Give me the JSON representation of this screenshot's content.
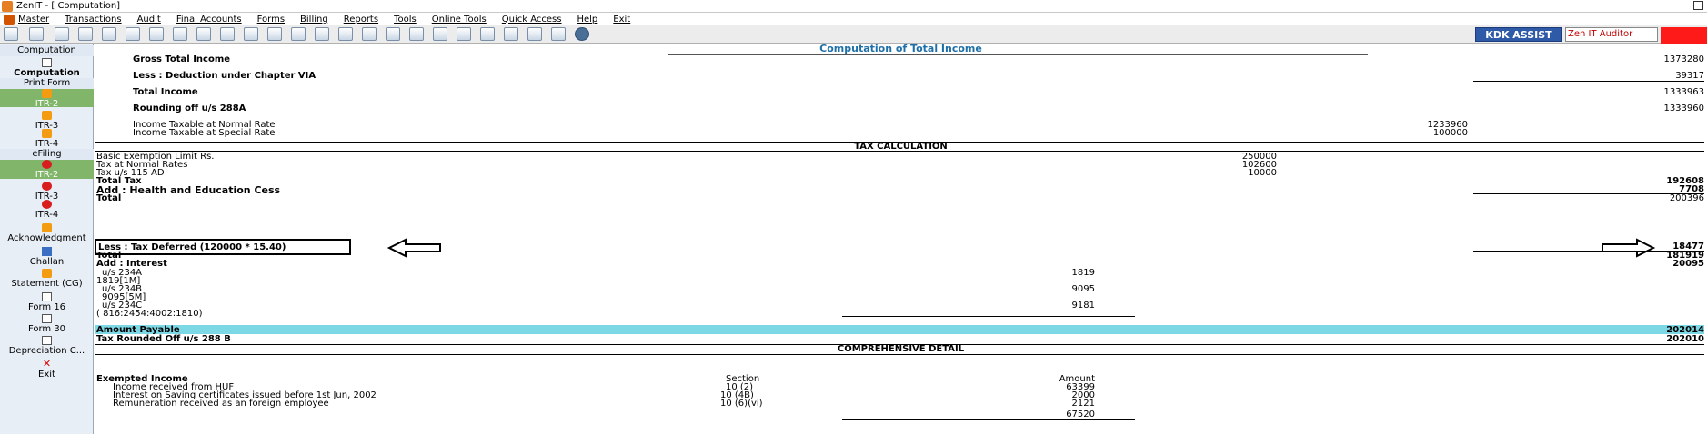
{
  "window": {
    "title": "ZenIT - [ Computation]"
  },
  "menu": [
    "Master",
    "Transactions",
    "Audit",
    "Final Accounts",
    "Forms",
    "Billing",
    "Reports",
    "Tools",
    "Online Tools",
    "Quick Access",
    "Help",
    "Exit"
  ],
  "toolbar": {
    "kdk_label": "KDK ASSIST",
    "zen_label": "Zen IT Auditor"
  },
  "sidebar": {
    "heading": "Computation",
    "computation_label": "Computation",
    "print_form_heading": "Print Form",
    "itr2_label": "ITR-2",
    "itr3_label": "ITR-3",
    "itr4_label": "ITR-4",
    "efiling_heading": "eFiling",
    "e_itr2_label": "ITR-2",
    "e_itr3_label": "ITR-3",
    "e_itr4_label": "ITR-4",
    "ack_label": "Acknowledgment",
    "challan_label": "Challan",
    "statement_label": "Statement (CG)",
    "form16_label": "Form 16",
    "form30_label": "Form 30",
    "depreciation_label": "Depreciation C...",
    "exit_label": "Exit"
  },
  "computation": {
    "title": "Computation of Total Income",
    "gross_total_label": "Gross Total Income",
    "gross_total_value": "1373280",
    "deduction_label": "Less : Deduction under Chapter VIA",
    "deduction_value": "39317",
    "total_income_label": "Total Income",
    "total_income_value": "1333963",
    "rounding_label": "Rounding off u/s 288A",
    "rounding_value": "1333960",
    "normal_rate_label": "Income Taxable at Normal Rate",
    "normal_rate_value": "1233960",
    "special_rate_label": "Income Taxable at Special Rate",
    "special_rate_value": "100000"
  },
  "tax": {
    "title": "TAX CALCULATION",
    "basic_exemption_label": "Basic Exemption Limit Rs.",
    "basic_exemption_value": "250000",
    "normal_rates_label": "Tax at Normal Rates",
    "normal_rates_value": "102600",
    "tax_115ad_label": "Tax u/s 115 AD",
    "tax_115ad_value": "10000",
    "total_tax_label": "Total Tax",
    "total_tax_value": "192608",
    "cess_label": "Add : Health and Education Cess",
    "cess_value": "7708",
    "total1_label": "Total",
    "total1_value": "200396",
    "deferred_label": "Less : Tax Deferred (120000 * 15.40)",
    "deferred_value": "18477",
    "total2_label": "Total",
    "total2_value": "181919",
    "add_interest_label": "Add : Interest",
    "add_interest_value": "20095",
    "i234a_label": "u/s 234A",
    "i234a_value": "1819",
    "i234a_detail": "1819[1M]",
    "i234b_label": "u/s 234B",
    "i234b_value": "9095",
    "i234b_detail": "9095[5M]",
    "i234c_label": "u/s 234C",
    "i234c_value": "9181",
    "i234c_detail": "( 816:2454:4002:1810)",
    "payable_label": "Amount Payable",
    "payable_value": "202014",
    "rounded_label": "Tax Rounded Off u/s 288 B",
    "rounded_value": "202010"
  },
  "comprehensive": {
    "title": "COMPREHENSIVE DETAIL",
    "exempted_label": "Exempted Income",
    "section_header": "Section",
    "amount_header": "Amount",
    "rows": [
      {
        "label": "Income received from HUF",
        "section": "10 (2)",
        "amount": "63399"
      },
      {
        "label": "Interest on Saving certificates issued before 1st Jun, 2002",
        "section": "10 (4B)",
        "amount": "2000"
      },
      {
        "label": "Remuneration received as an foreign employee",
        "section": "10 (6)(vi)",
        "amount": "2121"
      }
    ],
    "total_value": "67520"
  }
}
